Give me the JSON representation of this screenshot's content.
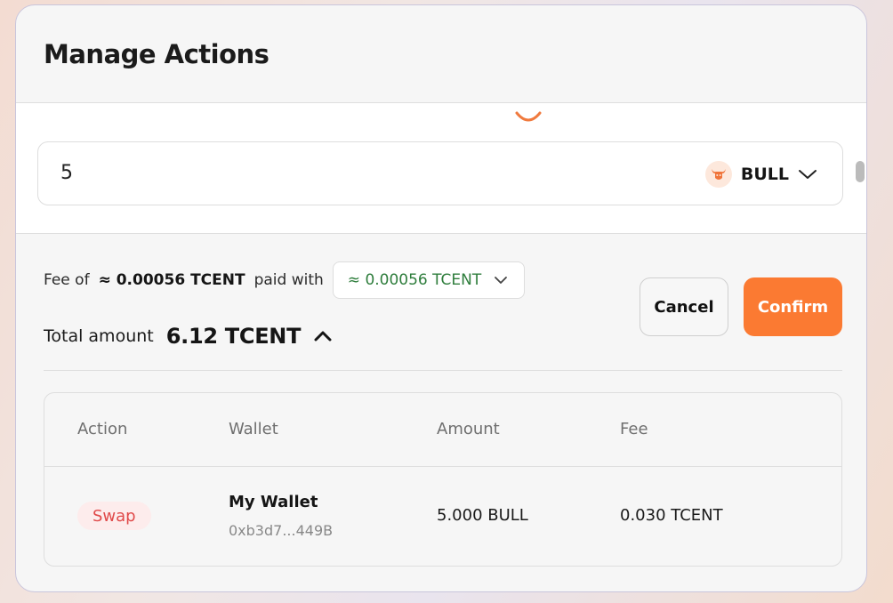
{
  "modal": {
    "title": "Manage Actions"
  },
  "input": {
    "amount": "5",
    "token": "BULL",
    "token_icon": "bull-icon"
  },
  "fee": {
    "prefix": "Fee of",
    "amount": "≈ 0.00056 TCENT",
    "paid_with_label": "paid with",
    "selected_option": "≈ 0.00056 TCENT"
  },
  "total": {
    "label": "Total amount",
    "value": "6.12 TCENT"
  },
  "buttons": {
    "cancel": "Cancel",
    "confirm": "Confirm"
  },
  "table": {
    "headers": [
      "Action",
      "Wallet",
      "Amount",
      "Fee"
    ],
    "rows": [
      {
        "action": "Swap",
        "wallet_name": "My Wallet",
        "wallet_address": "0xb3d7...449B",
        "amount": "5.000 BULL",
        "fee": "0.030 TCENT"
      }
    ]
  },
  "colors": {
    "accent": "#fb7a32",
    "fee_green": "#2e7d3c",
    "swap_red": "#e04a4a",
    "swap_bg": "#fdecec"
  }
}
